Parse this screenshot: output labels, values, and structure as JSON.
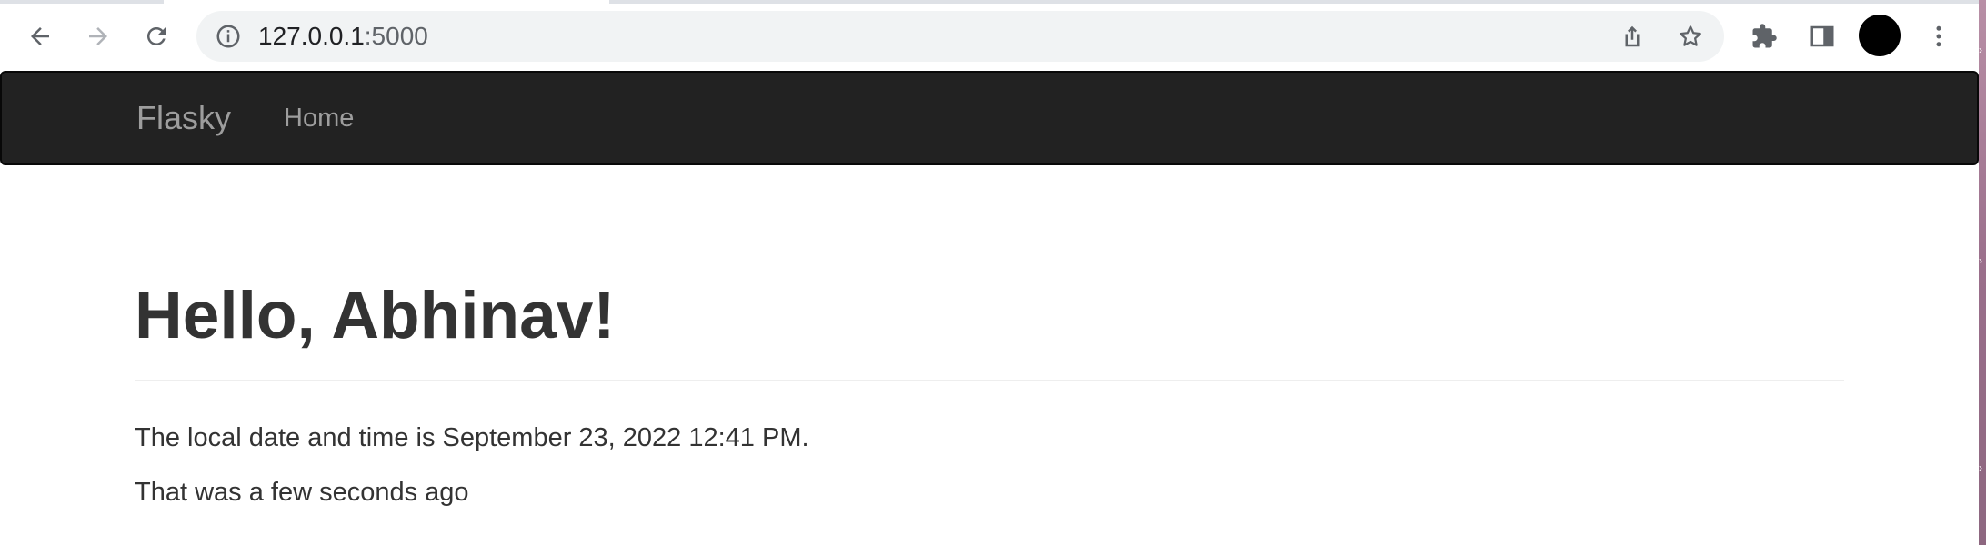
{
  "browser": {
    "url_host": "127.0.0.1",
    "url_port": ":5000",
    "icons": {
      "back": "arrow-left-icon",
      "forward": "arrow-right-icon",
      "reload": "reload-icon",
      "site_info": "info-icon",
      "share": "share-icon",
      "bookmark": "star-icon",
      "extensions": "puzzle-icon",
      "side_panel": "side-panel-icon",
      "profile": "avatar",
      "menu": "kebab-menu-icon"
    }
  },
  "navbar": {
    "brand": "Flasky",
    "items": [
      {
        "label": "Home"
      }
    ]
  },
  "main": {
    "heading": "Hello, Abhinav!",
    "datetime_text": "The local date and time is September 23, 2022 12:41 PM.",
    "relative_text": "That was a few seconds ago"
  },
  "colors": {
    "navbar_bg": "#222222",
    "navbar_text": "#9d9d9d",
    "body_text": "#333333"
  }
}
